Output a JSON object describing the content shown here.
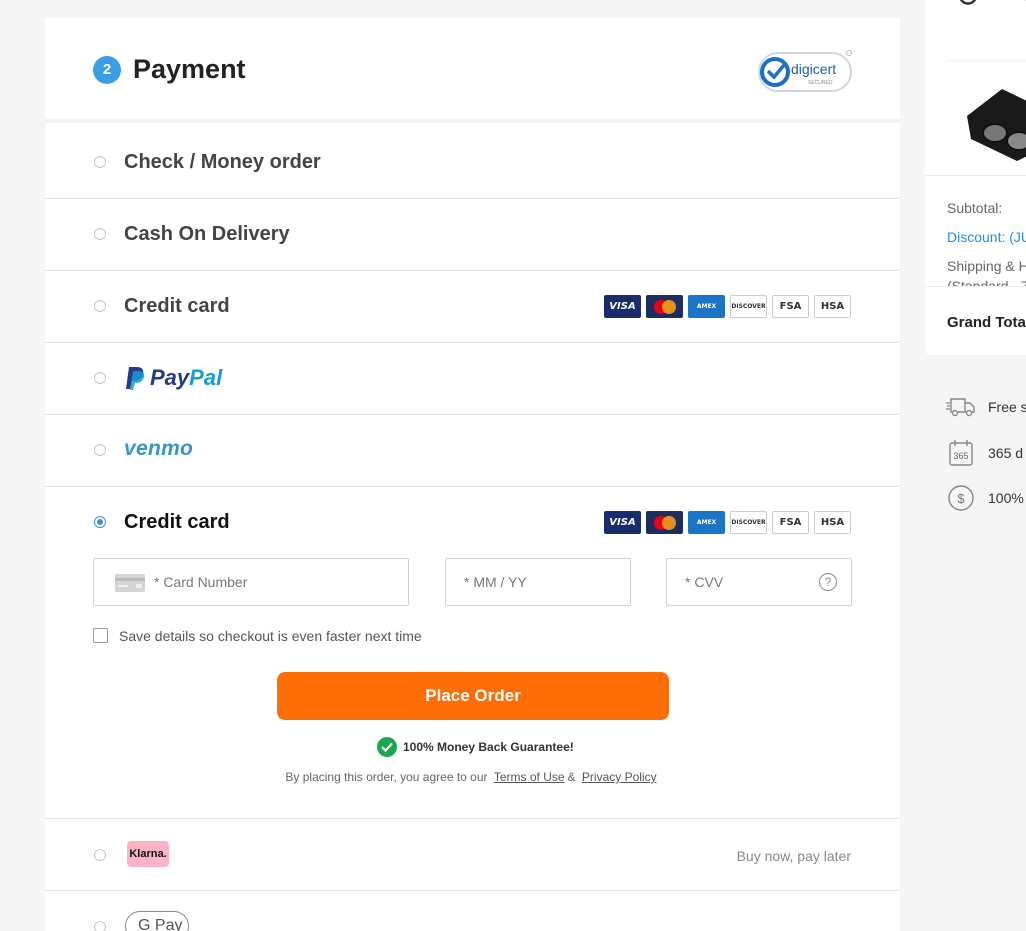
{
  "payment": {
    "step": "2",
    "title": "Payment",
    "security_badge": "digicert",
    "security_badge_sub": "SECURED"
  },
  "methods": [
    {
      "label": "Check / Money order",
      "selected": false
    },
    {
      "label": "Cash On Delivery",
      "selected": false
    },
    {
      "label": "Credit card",
      "selected": false
    },
    {
      "label": "PayPal",
      "selected": false
    },
    {
      "label": "venmo",
      "selected": false
    },
    {
      "label": "Credit card",
      "selected": true
    }
  ],
  "card_brands": [
    "VISA",
    "MC",
    "AMEX",
    "DISCOVER",
    "FSA",
    "HSA"
  ],
  "form": {
    "card_number_placeholder": "* Card Number",
    "expiry_placeholder": "* MM / YY",
    "cvv_placeholder": "* CVV",
    "cvv_help": "?",
    "save_details": "Save details so checkout is even faster next time",
    "save_checked": false
  },
  "place_order": "Place Order",
  "guarantee": "100% Money Back Guarantee!",
  "terms": {
    "prefix": "By placing this order, you agree to our",
    "terms_link": "Terms of Use",
    "amp": "&",
    "privacy_link": "Privacy Policy"
  },
  "klarna": {
    "logo": "Klarna.",
    "tagline": "Buy now, pay later"
  },
  "gpay": {
    "label": "G Pay"
  },
  "summary": {
    "subtotal": "Subtotal:",
    "discount": "Discount: (JU",
    "shipping": "Shipping & H",
    "shipping_sub": "(Standard - 7",
    "grand_total": "Grand Total"
  },
  "perks": [
    {
      "icon": "truck-icon",
      "text": "Free s"
    },
    {
      "icon": "calendar-365-icon",
      "text": "365 d",
      "badge": "365"
    },
    {
      "icon": "dollar-icon",
      "text": "100%",
      "badge": "$"
    }
  ],
  "colors": {
    "accent": "#ff6d07",
    "link": "#1f8fe5",
    "radio": "#3a8fe0",
    "badge": "#3a9ee4",
    "success": "#1aa84f"
  }
}
